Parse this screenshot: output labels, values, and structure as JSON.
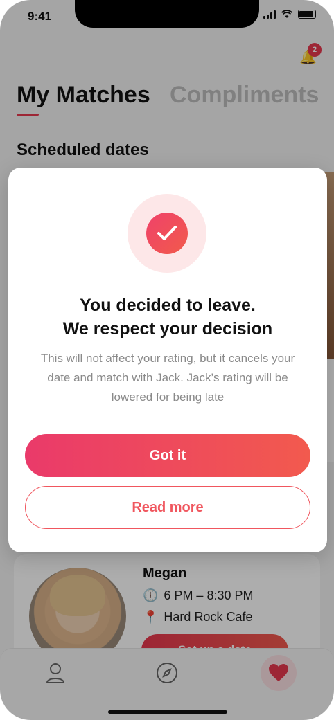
{
  "status_bar": {
    "time": "9:41"
  },
  "header": {
    "notification_count": "2",
    "tabs": [
      {
        "label": "My Matches",
        "active": true
      },
      {
        "label": "Compliments",
        "active": false
      }
    ]
  },
  "scheduled": {
    "title": "Scheduled dates",
    "match_card": {
      "name": "Megan",
      "time": "6 PM – 8:30 PM",
      "place": "Hard Rock Cafe",
      "button": "Set up a date"
    }
  },
  "modal": {
    "title_line1": "You decided to leave.",
    "title_line2": "We respect your decision",
    "body": "This will not affect your rating, but it cancels your date and match with Jack. Jack’s rating will be lowered for being late",
    "primary_button": "Got it",
    "secondary_button": "Read more"
  },
  "bottom_nav": {
    "items": [
      {
        "icon": "profile-icon"
      },
      {
        "icon": "compass-icon"
      },
      {
        "icon": "heart-icon",
        "active": true
      }
    ]
  },
  "colors": {
    "accent": "#e8384f",
    "gradient_start": "#ea3a6a",
    "gradient_end": "#f25a4e"
  }
}
